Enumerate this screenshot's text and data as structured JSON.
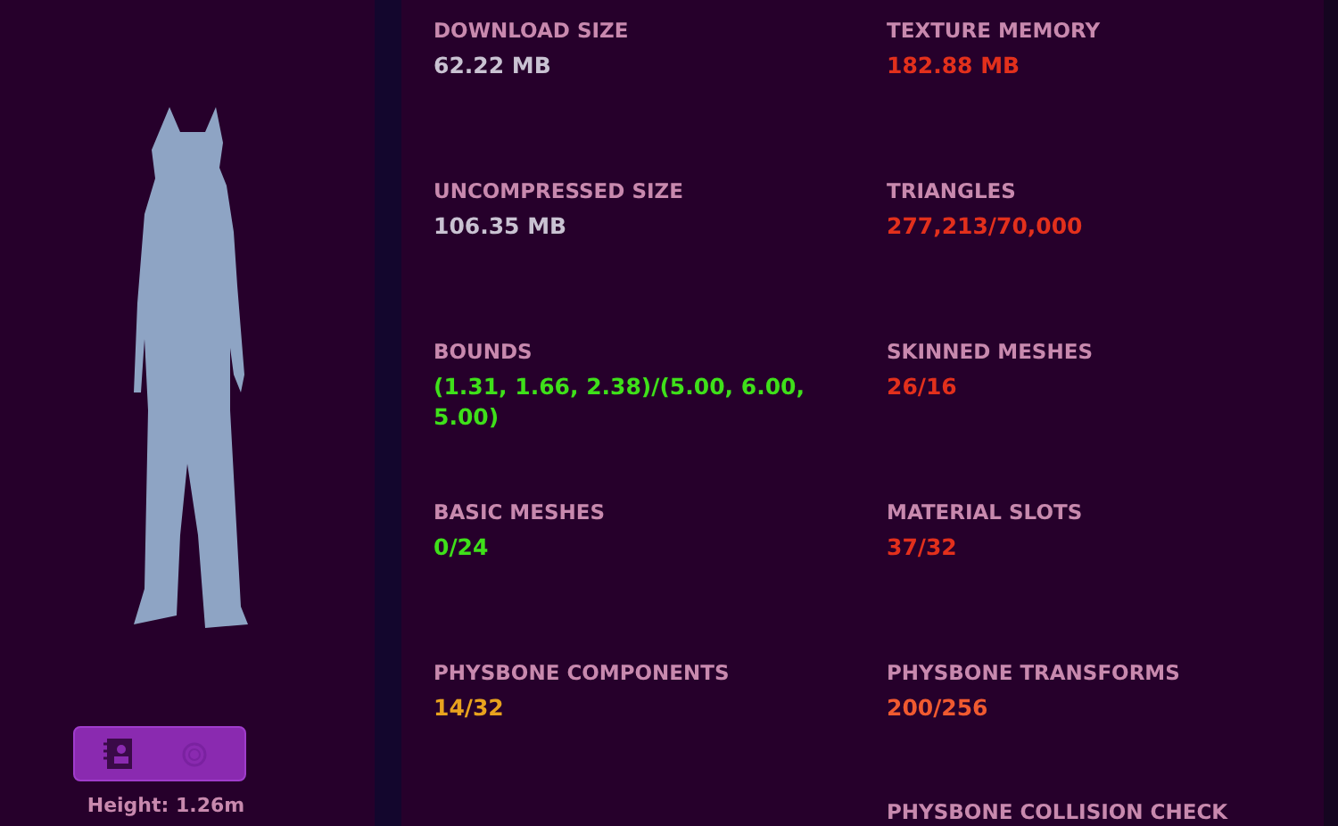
{
  "preview": {
    "height_label": "Height: 1.26m"
  },
  "stats": [
    {
      "label": "DOWNLOAD SIZE",
      "value": "62.22 MB",
      "color": "#c9c2d2"
    },
    {
      "label": "TEXTURE MEMORY",
      "value": "182.88 MB",
      "color": "#e2301c"
    },
    {
      "label": "UNCOMPRESSED SIZE",
      "value": "106.35 MB",
      "color": "#c9c2d2"
    },
    {
      "label": "TRIANGLES",
      "value": "277,213/70,000",
      "color": "#e2301c"
    },
    {
      "label": "BOUNDS",
      "value": "(1.31, 1.66, 2.38)/(5.00, 6.00, 5.00)",
      "color": "#3fe01a"
    },
    {
      "label": "SKINNED MESHES",
      "value": "26/16",
      "color": "#e2301c"
    },
    {
      "label": "BASIC MESHES",
      "value": "0/24",
      "color": "#3fe01a"
    },
    {
      "label": "MATERIAL SLOTS",
      "value": "37/32",
      "color": "#e2301c"
    },
    {
      "label": "PHYSBONE COMPONENTS",
      "value": "14/32",
      "color": "#e8a21e"
    },
    {
      "label": "PHYSBONE TRANSFORMS",
      "value": "200/256",
      "color": "#f05a30"
    },
    {
      "label": "PHYSBONE COLLISION CHECK"
    }
  ]
}
